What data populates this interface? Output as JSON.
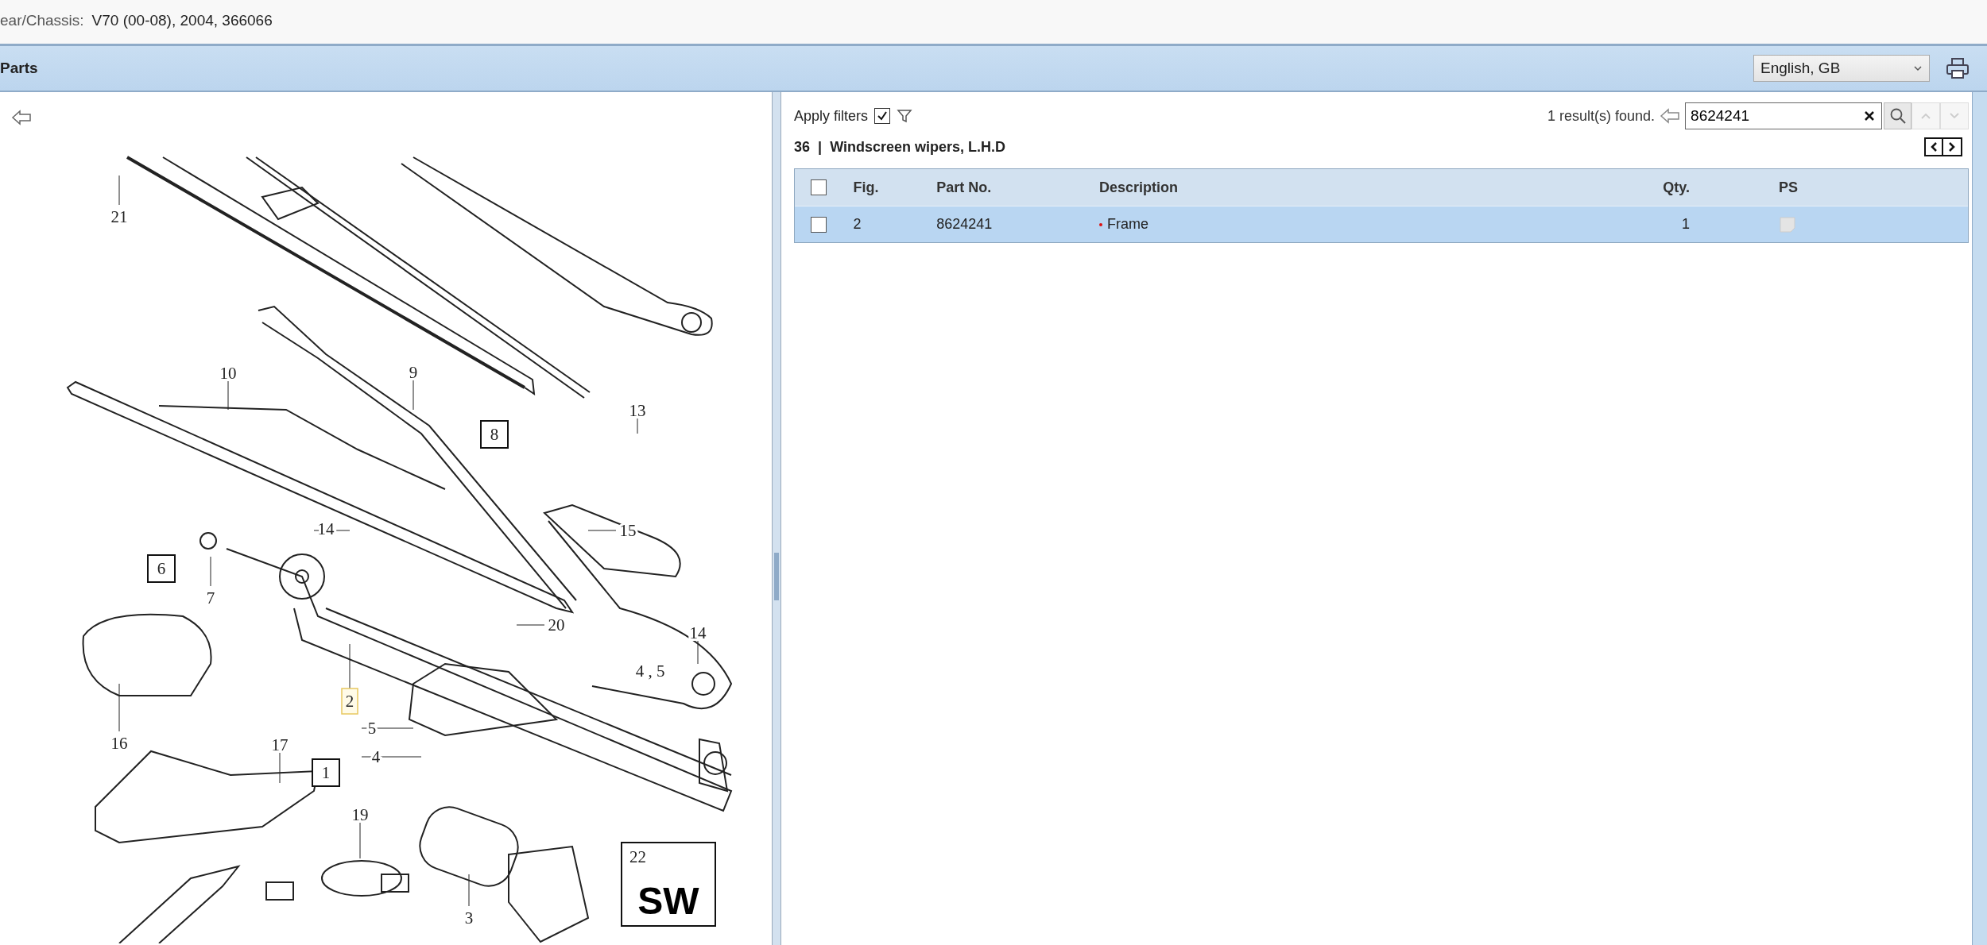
{
  "vehicle": {
    "label": "ear/Chassis:",
    "value": "V70 (00-08), 2004, 366066"
  },
  "header": {
    "title": "Parts",
    "language": "English, GB"
  },
  "diagram": {
    "callouts": [
      {
        "label": "21",
        "kind": "plain"
      },
      {
        "label": "10",
        "kind": "plain"
      },
      {
        "label": "9",
        "kind": "plain"
      },
      {
        "label": "8",
        "kind": "boxed"
      },
      {
        "label": "13",
        "kind": "plain"
      },
      {
        "label": "14",
        "kind": "plain"
      },
      {
        "label": "15",
        "kind": "plain"
      },
      {
        "label": "6",
        "kind": "boxed"
      },
      {
        "label": "7",
        "kind": "plain"
      },
      {
        "label": "20",
        "kind": "plain"
      },
      {
        "label": "14",
        "kind": "plain"
      },
      {
        "label": "4 , 5",
        "kind": "plain"
      },
      {
        "label": "2",
        "kind": "highlight"
      },
      {
        "label": "5",
        "kind": "plain"
      },
      {
        "label": "4",
        "kind": "plain"
      },
      {
        "label": "16",
        "kind": "plain"
      },
      {
        "label": "17",
        "kind": "plain"
      },
      {
        "label": "1",
        "kind": "boxed"
      },
      {
        "label": "19",
        "kind": "plain"
      },
      {
        "label": "3",
        "kind": "plain"
      }
    ],
    "code_box": {
      "number": "22",
      "code": "SW"
    }
  },
  "filters": {
    "label": "Apply filters",
    "checked": true
  },
  "search": {
    "result": "1 result(s) found.",
    "value": "8624241",
    "prev_disabled": true,
    "next_disabled": true
  },
  "group": {
    "number": "36",
    "separator": "|",
    "title": "Windscreen wipers, L.H.D"
  },
  "table": {
    "select_all": false,
    "columns": [
      "Fig.",
      "Part No.",
      "Description",
      "Qty.",
      "PS"
    ],
    "rows": [
      {
        "checked": false,
        "selected": true,
        "fig": "2",
        "part_no": "8624241",
        "description": "Frame",
        "qty": "1"
      }
    ]
  }
}
